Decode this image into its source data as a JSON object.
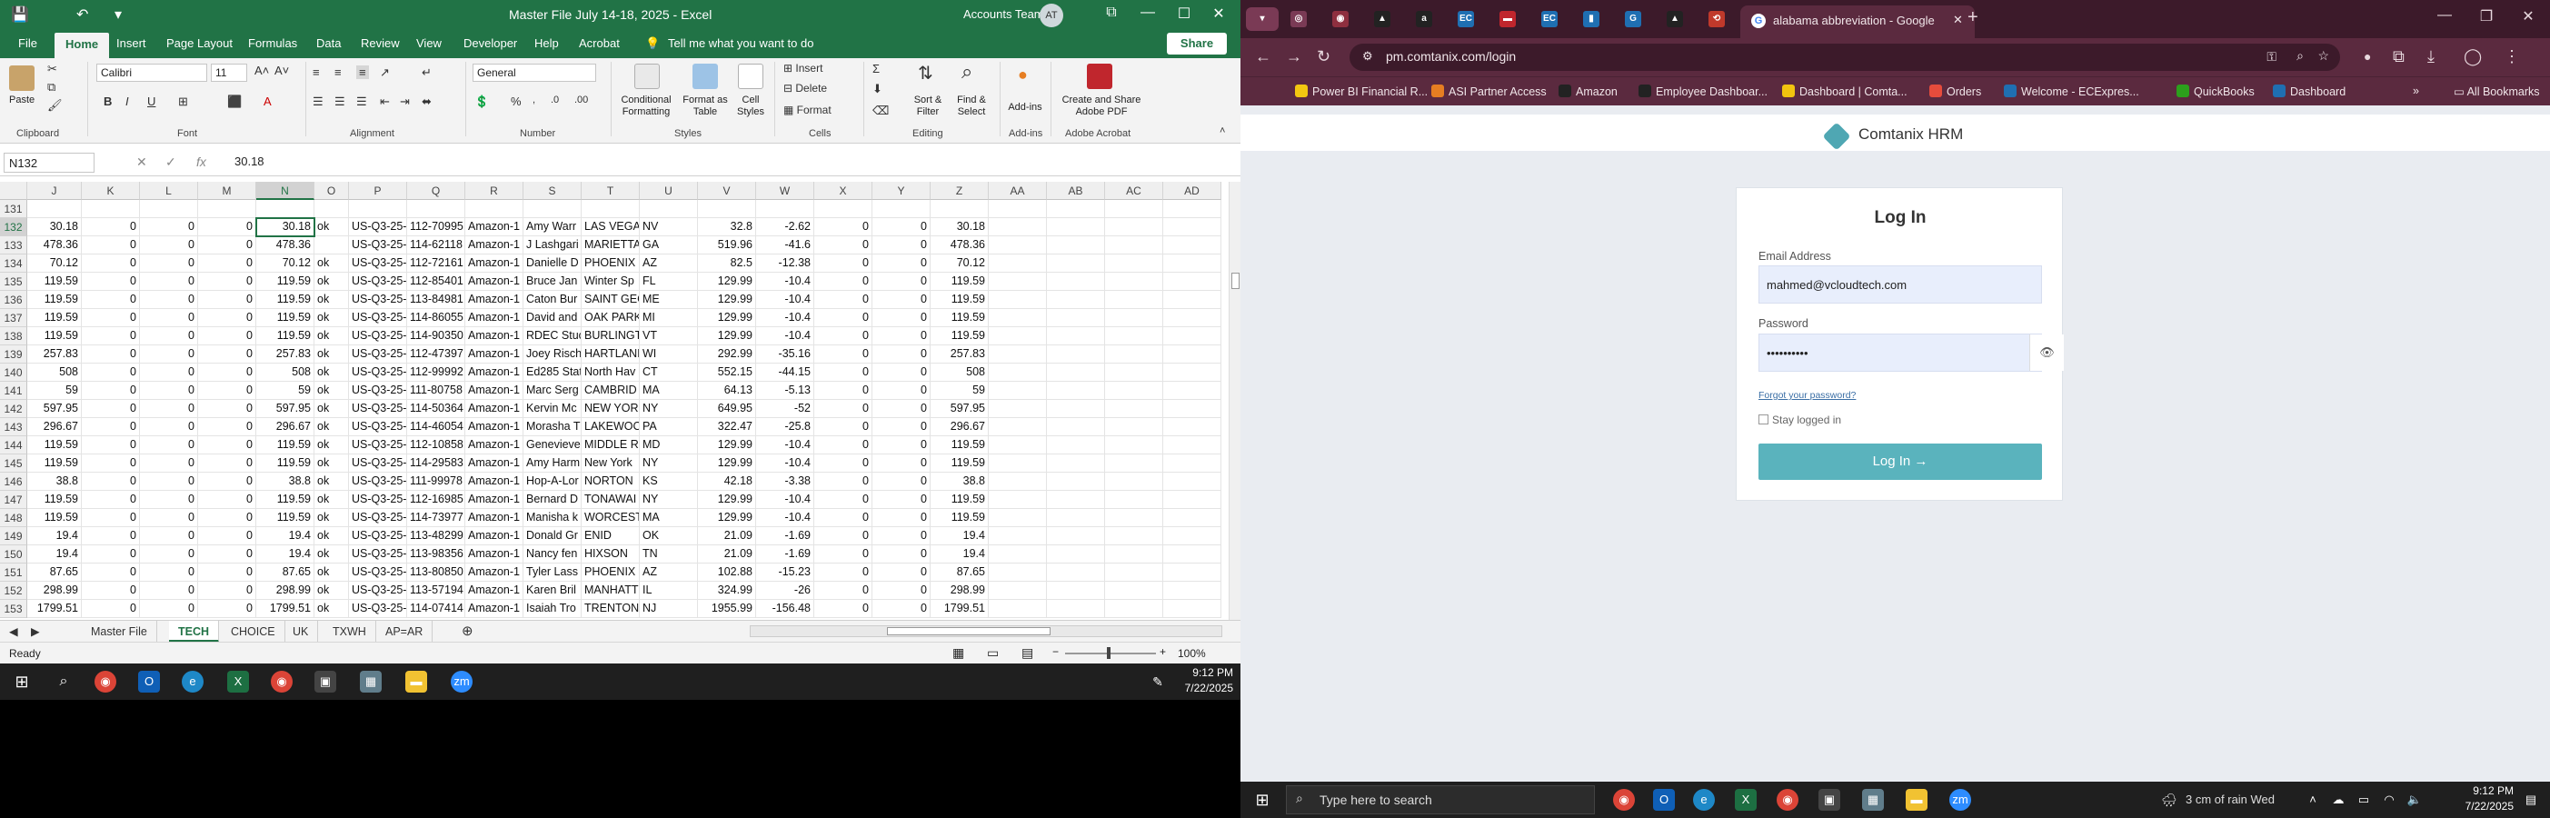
{
  "excel": {
    "quick_access": {
      "save": "💾",
      "undo": "↶",
      "redo": "↷",
      "more": "▾"
    },
    "doc_title": "Master File July 14-18, 2025  -  Excel",
    "account": "Accounts Team",
    "avatar": "AT",
    "window_controls": {
      "ribbon_opts": "⧉",
      "minimize": "—",
      "restore": "☐",
      "close": "✕"
    },
    "tabs": [
      "File",
      "Home",
      "Insert",
      "Page Layout",
      "Formulas",
      "Data",
      "Review",
      "View",
      "Developer",
      "Help",
      "Acrobat"
    ],
    "active_tab": "Home",
    "tell_me": "Tell me what you want to do",
    "share": "Share",
    "ribbon": {
      "paste": "Paste",
      "font_name": "Calibri",
      "font_size": "11",
      "number_format": "General",
      "groups": [
        "Clipboard",
        "Font",
        "Alignment",
        "Number",
        "Styles",
        "Cells",
        "Editing",
        "Add-ins",
        "Adobe Acrobat"
      ],
      "conditional": "Conditional Formatting",
      "format_table": "Format as Table",
      "cell_styles": "Cell Styles",
      "insert": "Insert",
      "delete": "Delete",
      "format": "Format",
      "sort_filter": "Sort & Filter",
      "find_select": "Find & Select",
      "addins": "Add-ins",
      "create_share": "Create and Share Adobe PDF"
    },
    "name_box": "N132",
    "formula_value": "30.18",
    "columns": [
      "J",
      "K",
      "L",
      "M",
      "N",
      "O",
      "P",
      "Q",
      "R",
      "S",
      "T",
      "U",
      "V",
      "W",
      "X",
      "Y",
      "Z",
      "AA",
      "AB",
      "AC",
      "AD"
    ],
    "rows": [
      {
        "n": "131",
        "c": [
          "",
          "",
          "",
          "",
          "",
          "",
          "",
          "",
          "",
          "",
          "",
          "",
          "",
          "",
          "",
          "",
          ""
        ]
      },
      {
        "n": "132",
        "c": [
          "30.18",
          "0",
          "0",
          "0",
          "30.18",
          "ok",
          "US-Q3-25-",
          "112-70995",
          "Amazon-1",
          "Amy Warr",
          "LAS VEGA",
          "NV",
          "32.8",
          "-2.62",
          "0",
          "0",
          "30.18"
        ]
      },
      {
        "n": "133",
        "c": [
          "478.36",
          "0",
          "0",
          "0",
          "478.36",
          "",
          "US-Q3-25-",
          "114-62118",
          "Amazon-1",
          "J Lashgari",
          "MARIETTA",
          "GA",
          "519.96",
          "-41.6",
          "0",
          "0",
          "478.36"
        ]
      },
      {
        "n": "134",
        "c": [
          "70.12",
          "0",
          "0",
          "0",
          "70.12",
          "ok",
          "US-Q3-25-",
          "112-72161",
          "Amazon-1",
          "Danielle D",
          "PHOENIX",
          "AZ",
          "82.5",
          "-12.38",
          "0",
          "0",
          "70.12"
        ]
      },
      {
        "n": "135",
        "c": [
          "119.59",
          "0",
          "0",
          "0",
          "119.59",
          "ok",
          "US-Q3-25-",
          "112-85401",
          "Amazon-1",
          "Bruce Jan",
          "Winter Sp",
          "FL",
          "129.99",
          "-10.4",
          "0",
          "0",
          "119.59"
        ]
      },
      {
        "n": "136",
        "c": [
          "119.59",
          "0",
          "0",
          "0",
          "119.59",
          "ok",
          "US-Q3-25-",
          "113-84981",
          "Amazon-1",
          "Caton Bur",
          "SAINT GEC",
          "ME",
          "129.99",
          "-10.4",
          "0",
          "0",
          "119.59"
        ]
      },
      {
        "n": "137",
        "c": [
          "119.59",
          "0",
          "0",
          "0",
          "119.59",
          "ok",
          "US-Q3-25-",
          "114-86055",
          "Amazon-1",
          "David and",
          "OAK PARK",
          "MI",
          "129.99",
          "-10.4",
          "0",
          "0",
          "119.59"
        ]
      },
      {
        "n": "138",
        "c": [
          "119.59",
          "0",
          "0",
          "0",
          "119.59",
          "ok",
          "US-Q3-25-",
          "114-90350",
          "Amazon-1",
          "RDEC Stuc",
          "BURLINGT",
          "VT",
          "129.99",
          "-10.4",
          "0",
          "0",
          "119.59"
        ]
      },
      {
        "n": "139",
        "c": [
          "257.83",
          "0",
          "0",
          "0",
          "257.83",
          "ok",
          "US-Q3-25-",
          "112-47397",
          "Amazon-1",
          "Joey Risch",
          "HARTLANI",
          "WI",
          "292.99",
          "-35.16",
          "0",
          "0",
          "257.83"
        ]
      },
      {
        "n": "140",
        "c": [
          "508",
          "0",
          "0",
          "0",
          "508",
          "ok",
          "US-Q3-25-",
          "112-99992",
          "Amazon-1",
          "Ed285 Stat",
          "North Hav",
          "CT",
          "552.15",
          "-44.15",
          "0",
          "0",
          "508"
        ]
      },
      {
        "n": "141",
        "c": [
          "59",
          "0",
          "0",
          "0",
          "59",
          "ok",
          "US-Q3-25-",
          "111-80758",
          "Amazon-1",
          "Marc Serg",
          "CAMBRID",
          "MA",
          "64.13",
          "-5.13",
          "0",
          "0",
          "59"
        ]
      },
      {
        "n": "142",
        "c": [
          "597.95",
          "0",
          "0",
          "0",
          "597.95",
          "ok",
          "US-Q3-25-",
          "114-50364",
          "Amazon-1",
          "Kervin Mc",
          "NEW YORI",
          "NY",
          "649.95",
          "-52",
          "0",
          "0",
          "597.95"
        ]
      },
      {
        "n": "143",
        "c": [
          "296.67",
          "0",
          "0",
          "0",
          "296.67",
          "ok",
          "US-Q3-25-",
          "114-46054",
          "Amazon-1",
          "Morasha T",
          "LAKEWOC",
          "PA",
          "322.47",
          "-25.8",
          "0",
          "0",
          "296.67"
        ]
      },
      {
        "n": "144",
        "c": [
          "119.59",
          "0",
          "0",
          "0",
          "119.59",
          "ok",
          "US-Q3-25-",
          "112-10858",
          "Amazon-1",
          "Genevieve",
          "MIDDLE RI",
          "MD",
          "129.99",
          "-10.4",
          "0",
          "0",
          "119.59"
        ]
      },
      {
        "n": "145",
        "c": [
          "119.59",
          "0",
          "0",
          "0",
          "119.59",
          "ok",
          "US-Q3-25-",
          "114-29583",
          "Amazon-1",
          "Amy Harm",
          "New York",
          "NY",
          "129.99",
          "-10.4",
          "0",
          "0",
          "119.59"
        ]
      },
      {
        "n": "146",
        "c": [
          "38.8",
          "0",
          "0",
          "0",
          "38.8",
          "ok",
          "US-Q3-25-",
          "111-99978",
          "Amazon-1",
          "Hop-A-Lor",
          "NORTON",
          "KS",
          "42.18",
          "-3.38",
          "0",
          "0",
          "38.8"
        ]
      },
      {
        "n": "147",
        "c": [
          "119.59",
          "0",
          "0",
          "0",
          "119.59",
          "ok",
          "US-Q3-25-",
          "112-16985",
          "Amazon-1",
          "Bernard D",
          "TONAWAI",
          "NY",
          "129.99",
          "-10.4",
          "0",
          "0",
          "119.59"
        ]
      },
      {
        "n": "148",
        "c": [
          "119.59",
          "0",
          "0",
          "0",
          "119.59",
          "ok",
          "US-Q3-25-",
          "114-73977",
          "Amazon-1",
          "Manisha k",
          "WORCEST",
          "MA",
          "129.99",
          "-10.4",
          "0",
          "0",
          "119.59"
        ]
      },
      {
        "n": "149",
        "c": [
          "19.4",
          "0",
          "0",
          "0",
          "19.4",
          "ok",
          "US-Q3-25-",
          "113-48299",
          "Amazon-1",
          "Donald Gr",
          "ENID",
          "OK",
          "21.09",
          "-1.69",
          "0",
          "0",
          "19.4"
        ]
      },
      {
        "n": "150",
        "c": [
          "19.4",
          "0",
          "0",
          "0",
          "19.4",
          "ok",
          "US-Q3-25-",
          "113-98356",
          "Amazon-1",
          "Nancy fen",
          "HIXSON",
          "TN",
          "21.09",
          "-1.69",
          "0",
          "0",
          "19.4"
        ]
      },
      {
        "n": "151",
        "c": [
          "87.65",
          "0",
          "0",
          "0",
          "87.65",
          "ok",
          "US-Q3-25-",
          "113-80850",
          "Amazon-1",
          "Tyler Lass",
          "PHOENIX",
          "AZ",
          "102.88",
          "-15.23",
          "0",
          "0",
          "87.65"
        ]
      },
      {
        "n": "152",
        "c": [
          "298.99",
          "0",
          "0",
          "0",
          "298.99",
          "ok",
          "US-Q3-25-",
          "113-57194",
          "Amazon-1",
          "Karen Bril",
          "MANHATT",
          "IL",
          "324.99",
          "-26",
          "0",
          "0",
          "298.99"
        ]
      },
      {
        "n": "153",
        "c": [
          "1799.51",
          "0",
          "0",
          "0",
          "1799.51",
          "ok",
          "US-Q3-25-",
          "114-07414",
          "Amazon-1",
          "Isaiah Tro",
          "TRENTON",
          "NJ",
          "1955.99",
          "-156.48",
          "0",
          "0",
          "1799.51"
        ]
      }
    ],
    "sheets": [
      "Master File",
      "TECH",
      "CHOICE",
      "UK",
      "TXWH",
      "AP=AR"
    ],
    "active_sheet": "TECH",
    "status": "Ready",
    "zoom": "100%"
  },
  "taskbar_left": {
    "time": "9:12 PM",
    "date": "7/22/2025"
  },
  "chrome": {
    "active_tab_title": "alabama abbreviation - Google",
    "mini_tabs": [
      {
        "label": "◎",
        "color": "#7a3a55"
      },
      {
        "label": "◉",
        "color": "#8e2f3f"
      },
      {
        "label": "▲",
        "color": "#222222"
      },
      {
        "label": "a",
        "color": "#222222"
      },
      {
        "label": "EC",
        "color": "#1f6fb2"
      },
      {
        "label": "▬",
        "color": "#c0262d"
      },
      {
        "label": "EC",
        "color": "#1f6fb2"
      },
      {
        "label": "▮",
        "color": "#1f6fb2"
      },
      {
        "label": "G",
        "color": "#1f6fb2"
      },
      {
        "label": "▲",
        "color": "#222222"
      },
      {
        "label": "⟲",
        "color": "#c0392b"
      }
    ],
    "url": "pm.comtanix.com/login",
    "bookmarks": [
      {
        "label": "Power BI Financial R...",
        "color": "#f2c811"
      },
      {
        "label": "ASI Partner Access",
        "color": "#e67e22"
      },
      {
        "label": "Amazon",
        "color": "#222222"
      },
      {
        "label": "Employee Dashboar...",
        "color": "#222222"
      },
      {
        "label": "Dashboard | Comta...",
        "color": "#f1c40f"
      },
      {
        "label": "Orders",
        "color": "#e74c3c"
      },
      {
        "label": "Welcome - ECExpres...",
        "color": "#1f6fb2"
      },
      {
        "label": "QuickBooks",
        "color": "#2ca01c"
      },
      {
        "label": "Dashboard",
        "color": "#1f6fb2"
      }
    ],
    "all_bookmarks": "All Bookmarks",
    "page": {
      "brand": "Comtanix HRM",
      "heading": "Log In",
      "email_label": "Email Address",
      "email_value": "mahmed@vcloudtech.com",
      "password_label": "Password",
      "password_value": "••••••••••",
      "forgot": "Forgot your password?",
      "stay_logged": "Stay logged in",
      "login_button": "Log In →"
    }
  },
  "taskbar_right": {
    "search_placeholder": "Type here to search",
    "weather": "3 cm of rain Wed",
    "time": "9:12 PM",
    "date": "7/22/2025"
  }
}
